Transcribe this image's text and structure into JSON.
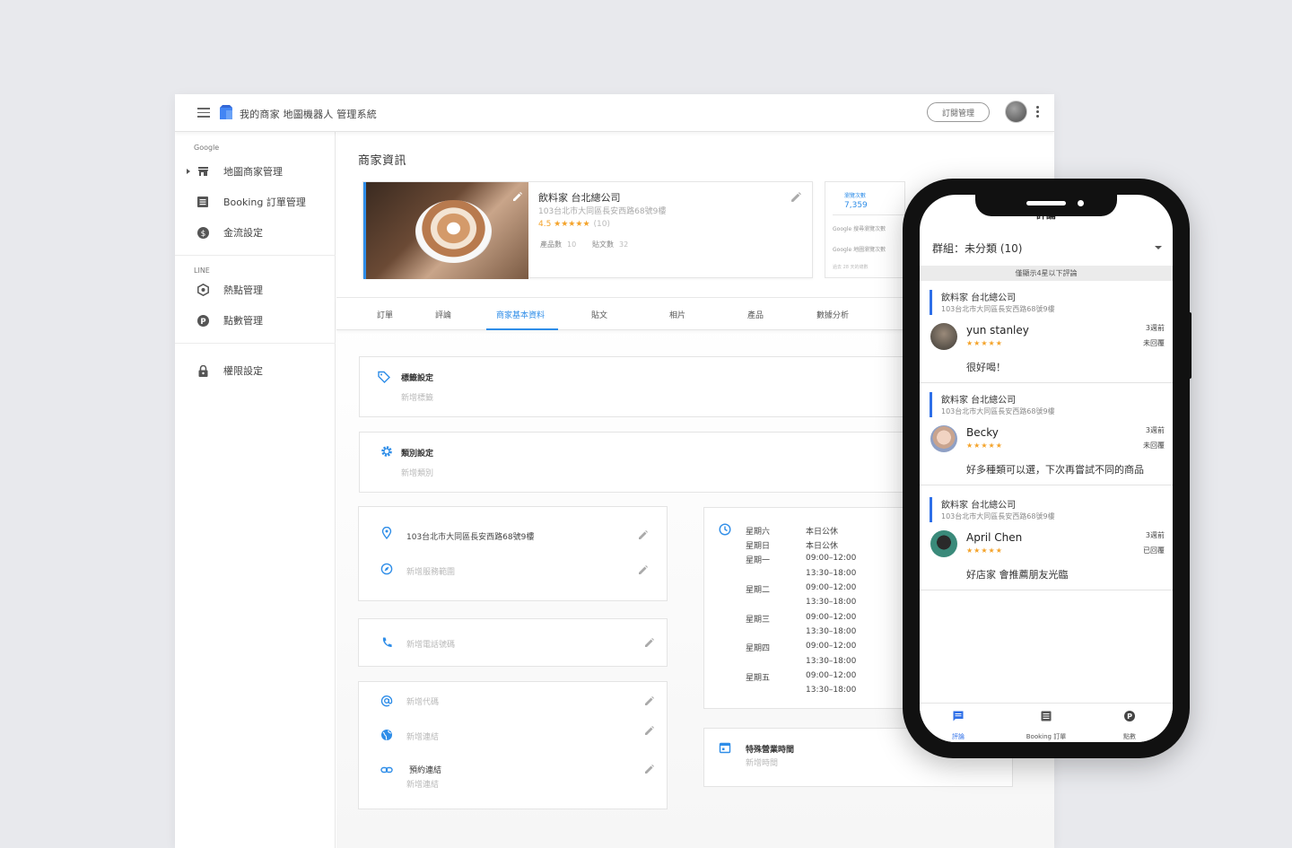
{
  "app": {
    "title": "我的商家 地圖機器人 管理系統",
    "subscription_button": "訂閱管理"
  },
  "sidebar": {
    "groups": [
      {
        "label": "Google",
        "items": [
          {
            "label": "地圖商家管理",
            "icon": "store-icon"
          },
          {
            "label": "Booking 訂單管理",
            "icon": "list-icon"
          },
          {
            "label": "金流設定",
            "icon": "dollar-icon"
          }
        ]
      },
      {
        "label": "LINE",
        "items": [
          {
            "label": "熱點管理",
            "icon": "hotspot-icon"
          },
          {
            "label": "點數管理",
            "icon": "points-icon"
          }
        ]
      }
    ],
    "permission_item": {
      "label": "權限設定",
      "icon": "lock-icon"
    }
  },
  "main": {
    "page_title": "商家資訊",
    "business": {
      "name": "飲料家 台北總公司",
      "address": "103台北市大同區長安西路68號9樓",
      "rating": "4.5 ★★★★★",
      "review_count": "(10)",
      "products_label": "產品數",
      "products_value": "10",
      "posts_label": "貼文數",
      "posts_value": "32"
    },
    "stats": {
      "views_label": "瀏覽次數",
      "views_value": "7,359",
      "lines": [
        "Google 搜尋瀏覽次數",
        "Google 地圖瀏覽次數",
        "過去 28 天的總數"
      ]
    },
    "tabs": [
      "訂單",
      "評論",
      "商家基本資料",
      "貼文",
      "相片",
      "產品",
      "數據分析"
    ],
    "active_tab": "商家基本資料",
    "tags": {
      "title": "標籤設定",
      "placeholder": "新增標籤"
    },
    "category": {
      "title": "類別設定",
      "placeholder": "新增類別"
    },
    "address_panel": {
      "address": "103台北市大同區長安西路68號9樓",
      "service_area": "新增服務範圍"
    },
    "phone_panel": {
      "placeholder": "新增電話號碼"
    },
    "links_panel": {
      "code": "新增代碼",
      "website": "新增連結",
      "booking_title": "預約連結",
      "booking_placeholder": "新增連結"
    },
    "hours": [
      {
        "day": "星期六",
        "slots": [
          "本日公休"
        ]
      },
      {
        "day": "星期日",
        "slots": [
          "本日公休"
        ]
      },
      {
        "day": "星期一",
        "slots": [
          "09:00–12:00",
          "13:30–18:00"
        ]
      },
      {
        "day": "星期二",
        "slots": [
          "09:00–12:00",
          "13:30–18:00"
        ]
      },
      {
        "day": "星期三",
        "slots": [
          "09:00–12:00",
          "13:30–18:00"
        ]
      },
      {
        "day": "星期四",
        "slots": [
          "09:00–12:00",
          "13:30–18:00"
        ]
      },
      {
        "day": "星期五",
        "slots": [
          "09:00–12:00",
          "13:30–18:00"
        ]
      }
    ],
    "special_hours": {
      "title": "特殊營業時間",
      "placeholder": "新增時間"
    }
  },
  "phone": {
    "header": "評論",
    "group": "群組：未分類 (10)",
    "notice": "僅顯示4星以下評論",
    "reviews": [
      {
        "store": "飲料家 台北總公司",
        "address": "103台北市大同區長安西路68號9樓",
        "name": "yun stanley",
        "stars": "★★★★★",
        "time": "3週前",
        "status": "未回覆",
        "text": "很好喝！"
      },
      {
        "store": "飲料家 台北總公司",
        "address": "103台北市大同區長安西路68號9樓",
        "name": "Becky",
        "stars": "★★★★★",
        "time": "3週前",
        "status": "未回覆",
        "text": "好多種類可以選，下次再嘗試不同的商品"
      },
      {
        "store": "飲料家 台北總公司",
        "address": "103台北市大同區長安西路68號9樓",
        "name": "April Chen",
        "stars": "★★★★★",
        "time": "3週前",
        "status": "已回覆",
        "text": "好店家 會推薦朋友光臨"
      }
    ],
    "nav": [
      {
        "label": "評論",
        "icon": "comment-icon"
      },
      {
        "label": "Booking 訂單",
        "icon": "list-icon"
      },
      {
        "label": "點數",
        "icon": "points-icon"
      }
    ]
  },
  "colors": {
    "accent": "#2e8de8",
    "star": "#f4a32a",
    "phone_accent": "#2e6fe8"
  }
}
